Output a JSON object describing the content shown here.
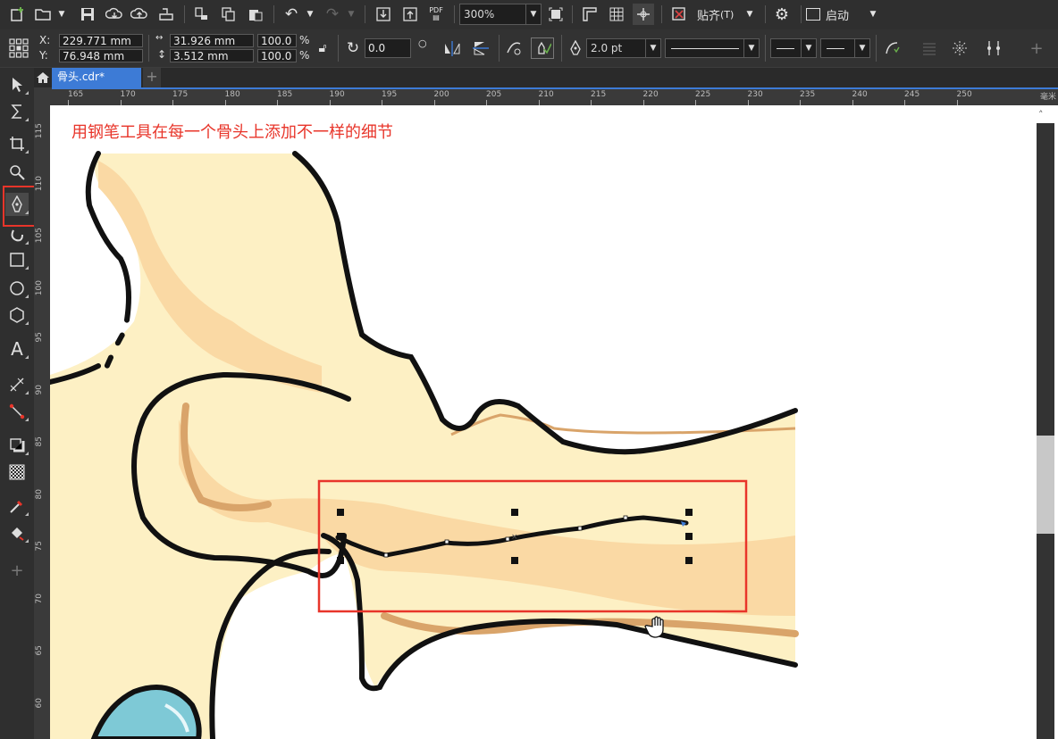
{
  "menubar": {
    "zoom": "300%",
    "snap_label": "贴齐",
    "snap_key": "(T)",
    "launch_label": "启动"
  },
  "props": {
    "x_label": "X:",
    "y_label": "Y:",
    "x_value": "229.771 mm",
    "y_value": "76.948 mm",
    "width_value": "31.926 mm",
    "height_value": "3.512 mm",
    "scale_x": "100.0",
    "scale_y": "100.0",
    "percent": "%",
    "rotation": "0.0",
    "outline_width": "2.0 pt"
  },
  "tab": {
    "home_icon": "home-icon",
    "filename": "骨头.cdr*",
    "add": "+"
  },
  "ruler": {
    "top_ticks": [
      "165",
      "170",
      "175",
      "180",
      "185",
      "190",
      "195",
      "200",
      "205",
      "210",
      "215",
      "220",
      "225",
      "230",
      "235",
      "240",
      "245",
      "250"
    ],
    "unit": "毫米",
    "left_ticks": [
      "115",
      "110",
      "105",
      "100",
      "95",
      "90",
      "85",
      "80",
      "75",
      "70",
      "65",
      "60"
    ]
  },
  "canvas": {
    "caption": "用钢笔工具在每一个骨头上添加不一样的细节"
  },
  "colors": {
    "bone_light": "#fdf0c4",
    "bone_mid": "#fad9a4",
    "bone_shadow": "#d9a46a",
    "outline": "#111111",
    "highlight_box": "#e8352a",
    "accent_blue": "#3d7bd6",
    "egg_blue": "#7ec9d6"
  }
}
